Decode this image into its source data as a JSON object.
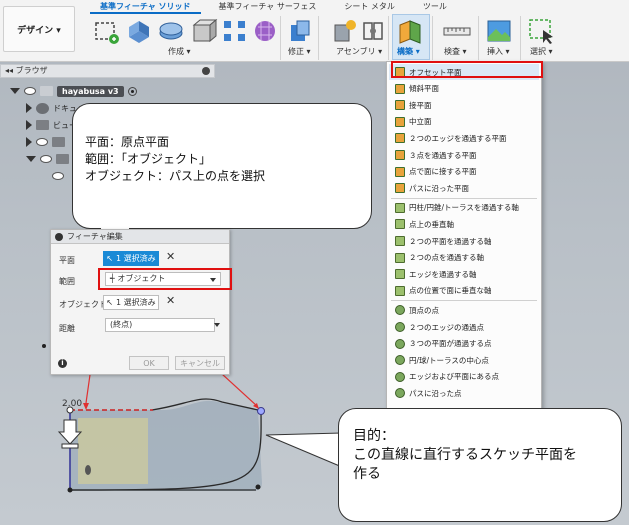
{
  "ribbon": {
    "workspace_button": "デザイン ▾",
    "tabs": [
      "基準フィーチャ ソリッド",
      "基準フィーチャ サーフェス",
      "シート メタル",
      "ツール"
    ],
    "active_tab": 0,
    "groups": {
      "create": "作成 ▾",
      "modify": "修正 ▾",
      "assemble": "アセンブリ ▾",
      "construct": "構築 ▾",
      "inspect": "検査 ▾",
      "insert": "挿入 ▾",
      "select": "選択 ▾"
    }
  },
  "browser": {
    "header": "ブラウザ",
    "root_label": "hayabusa v3",
    "items": [
      "ドキュメント設定",
      "ビュー",
      "",
      ""
    ]
  },
  "callout_top": {
    "lines": [
      "平面：原点平面",
      "範囲：「オブジェクト」",
      "オブジェクト：パス上の点を選択"
    ]
  },
  "callout_bottom": {
    "lines": [
      "目的：",
      "この直線に直行するスケッチ平面を",
      "作る"
    ]
  },
  "dialog": {
    "title": "フィーチャ編集",
    "plane_label": "平面",
    "plane_value": "1 選択済み",
    "extent_label": "範囲",
    "extent_value": "オブジェクト",
    "object_label": "オブジェクト",
    "object_value": "1 選択済み",
    "distance_label": "距離",
    "distance_value": "(終点)",
    "ok": "OK",
    "cancel": "キャンセル"
  },
  "construct_menu": {
    "items": [
      {
        "label": "オフセット平面",
        "kind": "plane"
      },
      {
        "label": "傾斜平面",
        "kind": "plane"
      },
      {
        "label": "接平面",
        "kind": "plane"
      },
      {
        "label": "中立面",
        "kind": "plane"
      },
      {
        "label": "２つのエッジを通過する平面",
        "kind": "plane"
      },
      {
        "label": "３点を通過する平面",
        "kind": "plane"
      },
      {
        "label": "点で面に接する平面",
        "kind": "plane"
      },
      {
        "label": "パスに沿った平面",
        "kind": "plane"
      },
      {
        "label": "円柱/円錐/トーラスを通過する軸",
        "kind": "axis"
      },
      {
        "label": "点上の垂直軸",
        "kind": "axis"
      },
      {
        "label": "２つの平面を通過する軸",
        "kind": "axis"
      },
      {
        "label": "２つの点を通過する軸",
        "kind": "axis"
      },
      {
        "label": "エッジを通過する軸",
        "kind": "axis"
      },
      {
        "label": "点の位置で面に垂直な軸",
        "kind": "axis"
      },
      {
        "label": "頂点の点",
        "kind": "point"
      },
      {
        "label": "２つのエッジの通過点",
        "kind": "point"
      },
      {
        "label": "３つの平面が通過する点",
        "kind": "point"
      },
      {
        "label": "円/球/トーラスの中心点",
        "kind": "point"
      },
      {
        "label": "エッジおよび平面にある点",
        "kind": "point"
      },
      {
        "label": "パスに沿った点",
        "kind": "point"
      }
    ]
  },
  "sketch": {
    "dimension_label": "2.00"
  },
  "colors": {
    "accent": "#1a8ad6",
    "highlight_red": "#e01010",
    "arrow_red": "#e03030",
    "sketch_line": "#2a2a2a",
    "sketch_fill": "#c9c8a0"
  }
}
